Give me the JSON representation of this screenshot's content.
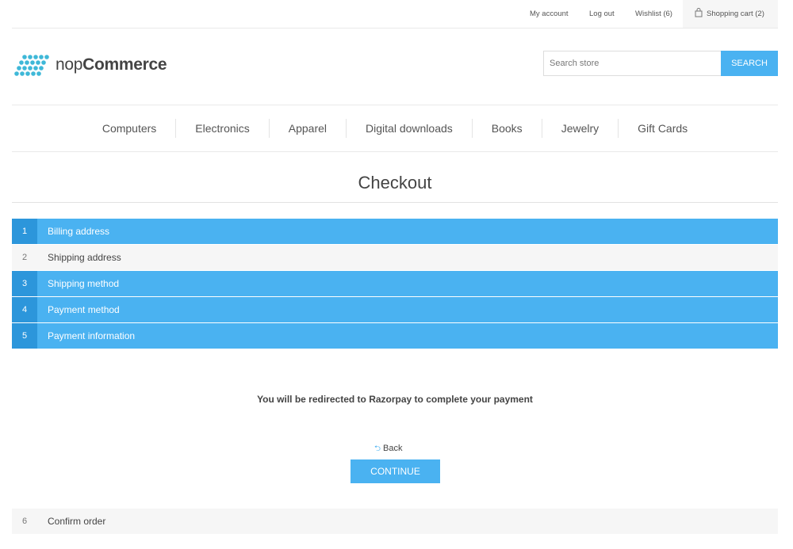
{
  "header": {
    "my_account": "My account",
    "log_out": "Log out",
    "wishlist": "Wishlist (6)",
    "shopping_cart": "Shopping cart (2)"
  },
  "logo": {
    "light": "nop",
    "bold": "Commerce"
  },
  "search": {
    "placeholder": "Search store",
    "button": "SEARCH"
  },
  "menu": [
    "Computers",
    "Electronics",
    "Apparel",
    "Digital downloads",
    "Books",
    "Jewelry",
    "Gift Cards"
  ],
  "page_title": "Checkout",
  "steps": [
    {
      "num": "1",
      "title": "Billing address",
      "active": true
    },
    {
      "num": "2",
      "title": "Shipping address",
      "active": false
    },
    {
      "num": "3",
      "title": "Shipping method",
      "active": true
    },
    {
      "num": "4",
      "title": "Payment method",
      "active": true
    },
    {
      "num": "5",
      "title": "Payment information",
      "active": true
    },
    {
      "num": "6",
      "title": "Confirm order",
      "active": false
    }
  ],
  "payment_info": {
    "message": "You will be redirected to Razorpay to complete your payment",
    "back": "Back",
    "continue": "CONTINUE"
  },
  "colors": {
    "accent": "#4ab2f1",
    "accent_dark": "#2c96db",
    "light_bg": "#f6f6f6"
  }
}
